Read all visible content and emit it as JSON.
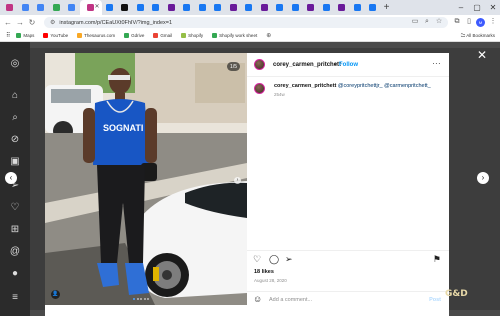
{
  "browser": {
    "tabs": [
      {
        "icon": "instagram-icon",
        "color": "#c13584"
      },
      {
        "icon": "doc-icon",
        "color": "#4285f4"
      },
      {
        "icon": "doc-icon",
        "color": "#4285f4"
      },
      {
        "icon": "drive-icon",
        "color": "#34a853"
      },
      {
        "icon": "doc-icon",
        "color": "#4285f4"
      },
      {
        "icon": "instagram-icon",
        "color": "#c13584",
        "active": true
      },
      {
        "icon": "facebook-icon",
        "color": "#1877f2"
      },
      {
        "icon": "x-icon",
        "color": "#111111"
      },
      {
        "icon": "facebook-icon",
        "color": "#1877f2"
      },
      {
        "icon": "facebook-icon",
        "color": "#1877f2"
      },
      {
        "icon": "check-icon",
        "color": "#6a1b9a"
      },
      {
        "icon": "facebook-icon",
        "color": "#1877f2"
      },
      {
        "icon": "facebook-icon",
        "color": "#1877f2"
      },
      {
        "icon": "facebook-icon",
        "color": "#1877f2"
      },
      {
        "icon": "check-icon",
        "color": "#6a1b9a"
      },
      {
        "icon": "facebook-icon",
        "color": "#1877f2"
      },
      {
        "icon": "check-icon",
        "color": "#6a1b9a"
      },
      {
        "icon": "facebook-icon",
        "color": "#1877f2"
      },
      {
        "icon": "facebook-icon",
        "color": "#1877f2"
      },
      {
        "icon": "check-icon",
        "color": "#6a1b9a"
      },
      {
        "icon": "facebook-icon",
        "color": "#1877f2"
      },
      {
        "icon": "check-icon",
        "color": "#6a1b9a"
      },
      {
        "icon": "facebook-icon",
        "color": "#1877f2"
      },
      {
        "icon": "facebook-icon",
        "color": "#1877f2"
      }
    ],
    "new_tab": "+",
    "url": "instagram.com/p/CEaUXt0FhIV/?img_index=1",
    "profile_initial": "M",
    "bookmarks": [
      {
        "label": "Maps",
        "color": "#34a853"
      },
      {
        "label": "YouTube",
        "color": "#ff0000"
      },
      {
        "label": "Thesaurus.com",
        "color": "#f9a825"
      },
      {
        "label": "Gdrive",
        "color": "#34a853"
      },
      {
        "label": "Gmail",
        "color": "#ea4335"
      },
      {
        "label": "Shopify",
        "color": "#95bf47"
      },
      {
        "label": "Shopify work sheet",
        "color": "#34a853"
      }
    ],
    "all_bookmarks": "All Bookmarks"
  },
  "post": {
    "username": "corey_carmen_pritchett",
    "follow_separator": "•",
    "follow_label": "Follow",
    "caption_user": "corey_carmen_pritchett",
    "caption_mentions": "@coreypritchettjr_ @carmenpritchett_",
    "caption_age": "254w",
    "likes": "18 likes",
    "date": "August 28, 2020",
    "comment_placeholder": "Add a comment...",
    "post_label": "Post",
    "photo_counter": "1/5",
    "photo_count": 5,
    "photo_index": 1
  },
  "colors": {
    "ig_blue": "#0095f6",
    "mention": "#00376b"
  },
  "watermark": "G&D"
}
